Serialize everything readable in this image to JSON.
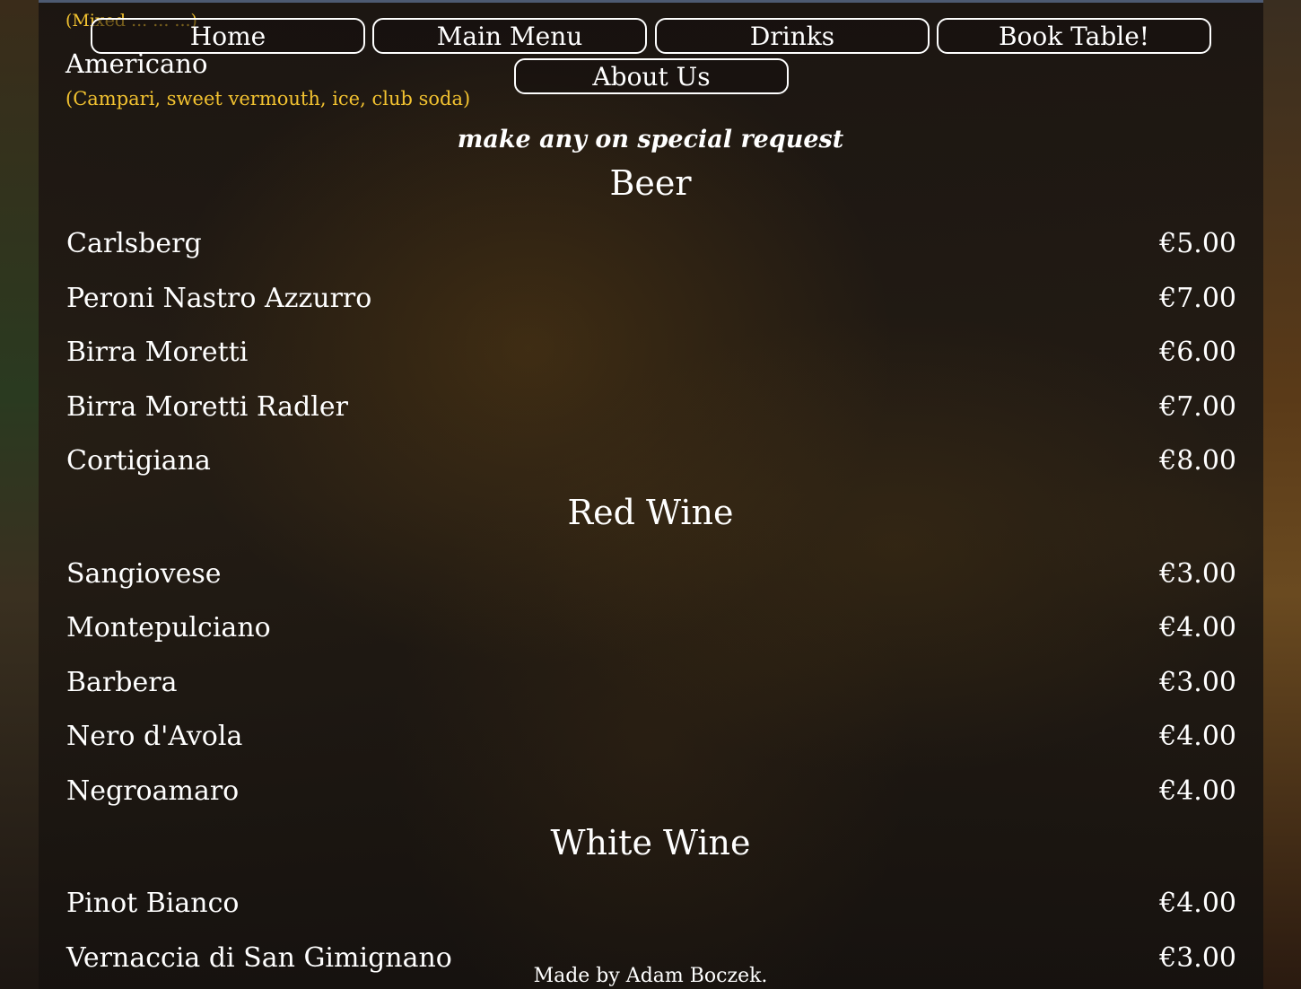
{
  "nav": {
    "home": "Home",
    "main_menu": "Main Menu",
    "drinks": "Drinks",
    "book_table": "Book Table!",
    "about_us": "About Us"
  },
  "partial_above": {
    "desc_top": "(Mixed ... ... ...)",
    "item": "Americano",
    "desc": "(Campari, sweet vermouth, ice, club soda)"
  },
  "note": "make any on special request",
  "sections": [
    {
      "title": "Beer",
      "items": [
        {
          "name": "Carlsberg",
          "price": "€5.00"
        },
        {
          "name": "Peroni Nastro Azzurro",
          "price": "€7.00"
        },
        {
          "name": "Birra Moretti",
          "price": "€6.00"
        },
        {
          "name": "Birra Moretti Radler",
          "price": "€7.00"
        },
        {
          "name": "Cortigiana",
          "price": "€8.00"
        }
      ]
    },
    {
      "title": "Red Wine",
      "items": [
        {
          "name": "Sangiovese",
          "price": "€3.00"
        },
        {
          "name": "Montepulciano",
          "price": "€4.00"
        },
        {
          "name": "Barbera",
          "price": "€3.00"
        },
        {
          "name": "Nero d'Avola",
          "price": "€4.00"
        },
        {
          "name": "Negroamaro",
          "price": "€4.00"
        }
      ]
    },
    {
      "title": "White Wine",
      "items": [
        {
          "name": "Pinot Bianco",
          "price": "€4.00"
        },
        {
          "name": "Vernaccia di San Gimignano",
          "price": "€3.00"
        }
      ]
    }
  ],
  "footer": "Made by Adam Boczek."
}
